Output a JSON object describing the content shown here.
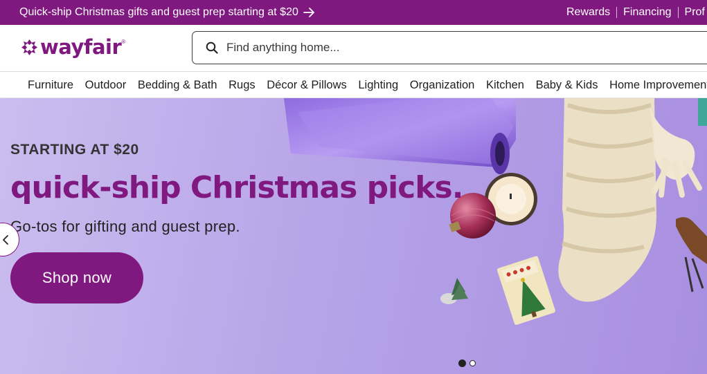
{
  "promo": {
    "message": "Quick-ship Christmas gifts and guest prep starting at $20",
    "links": [
      "Rewards",
      "Financing",
      "Prof"
    ]
  },
  "brand": {
    "name": "wayfair",
    "color": "#7f187f"
  },
  "search": {
    "placeholder": "Find anything home..."
  },
  "categories": [
    "Furniture",
    "Outdoor",
    "Bedding & Bath",
    "Rugs",
    "Décor & Pillows",
    "Lighting",
    "Organization",
    "Kitchen",
    "Baby & Kids",
    "Home Improvement"
  ],
  "hero": {
    "eyebrow": "STARTING AT $20",
    "headline": "quick-ship Christmas picks.",
    "subhead": "Go-tos for gifting and guest prep.",
    "cta_label": "Shop now",
    "slides_total": 2,
    "active_slide": 1
  },
  "colors": {
    "accent": "#7f187f",
    "hero_bg": "#b7a4e8"
  },
  "icons": [
    "arrow-right-icon",
    "search-icon",
    "chevron-left-icon",
    "wayfair-logo-icon"
  ]
}
